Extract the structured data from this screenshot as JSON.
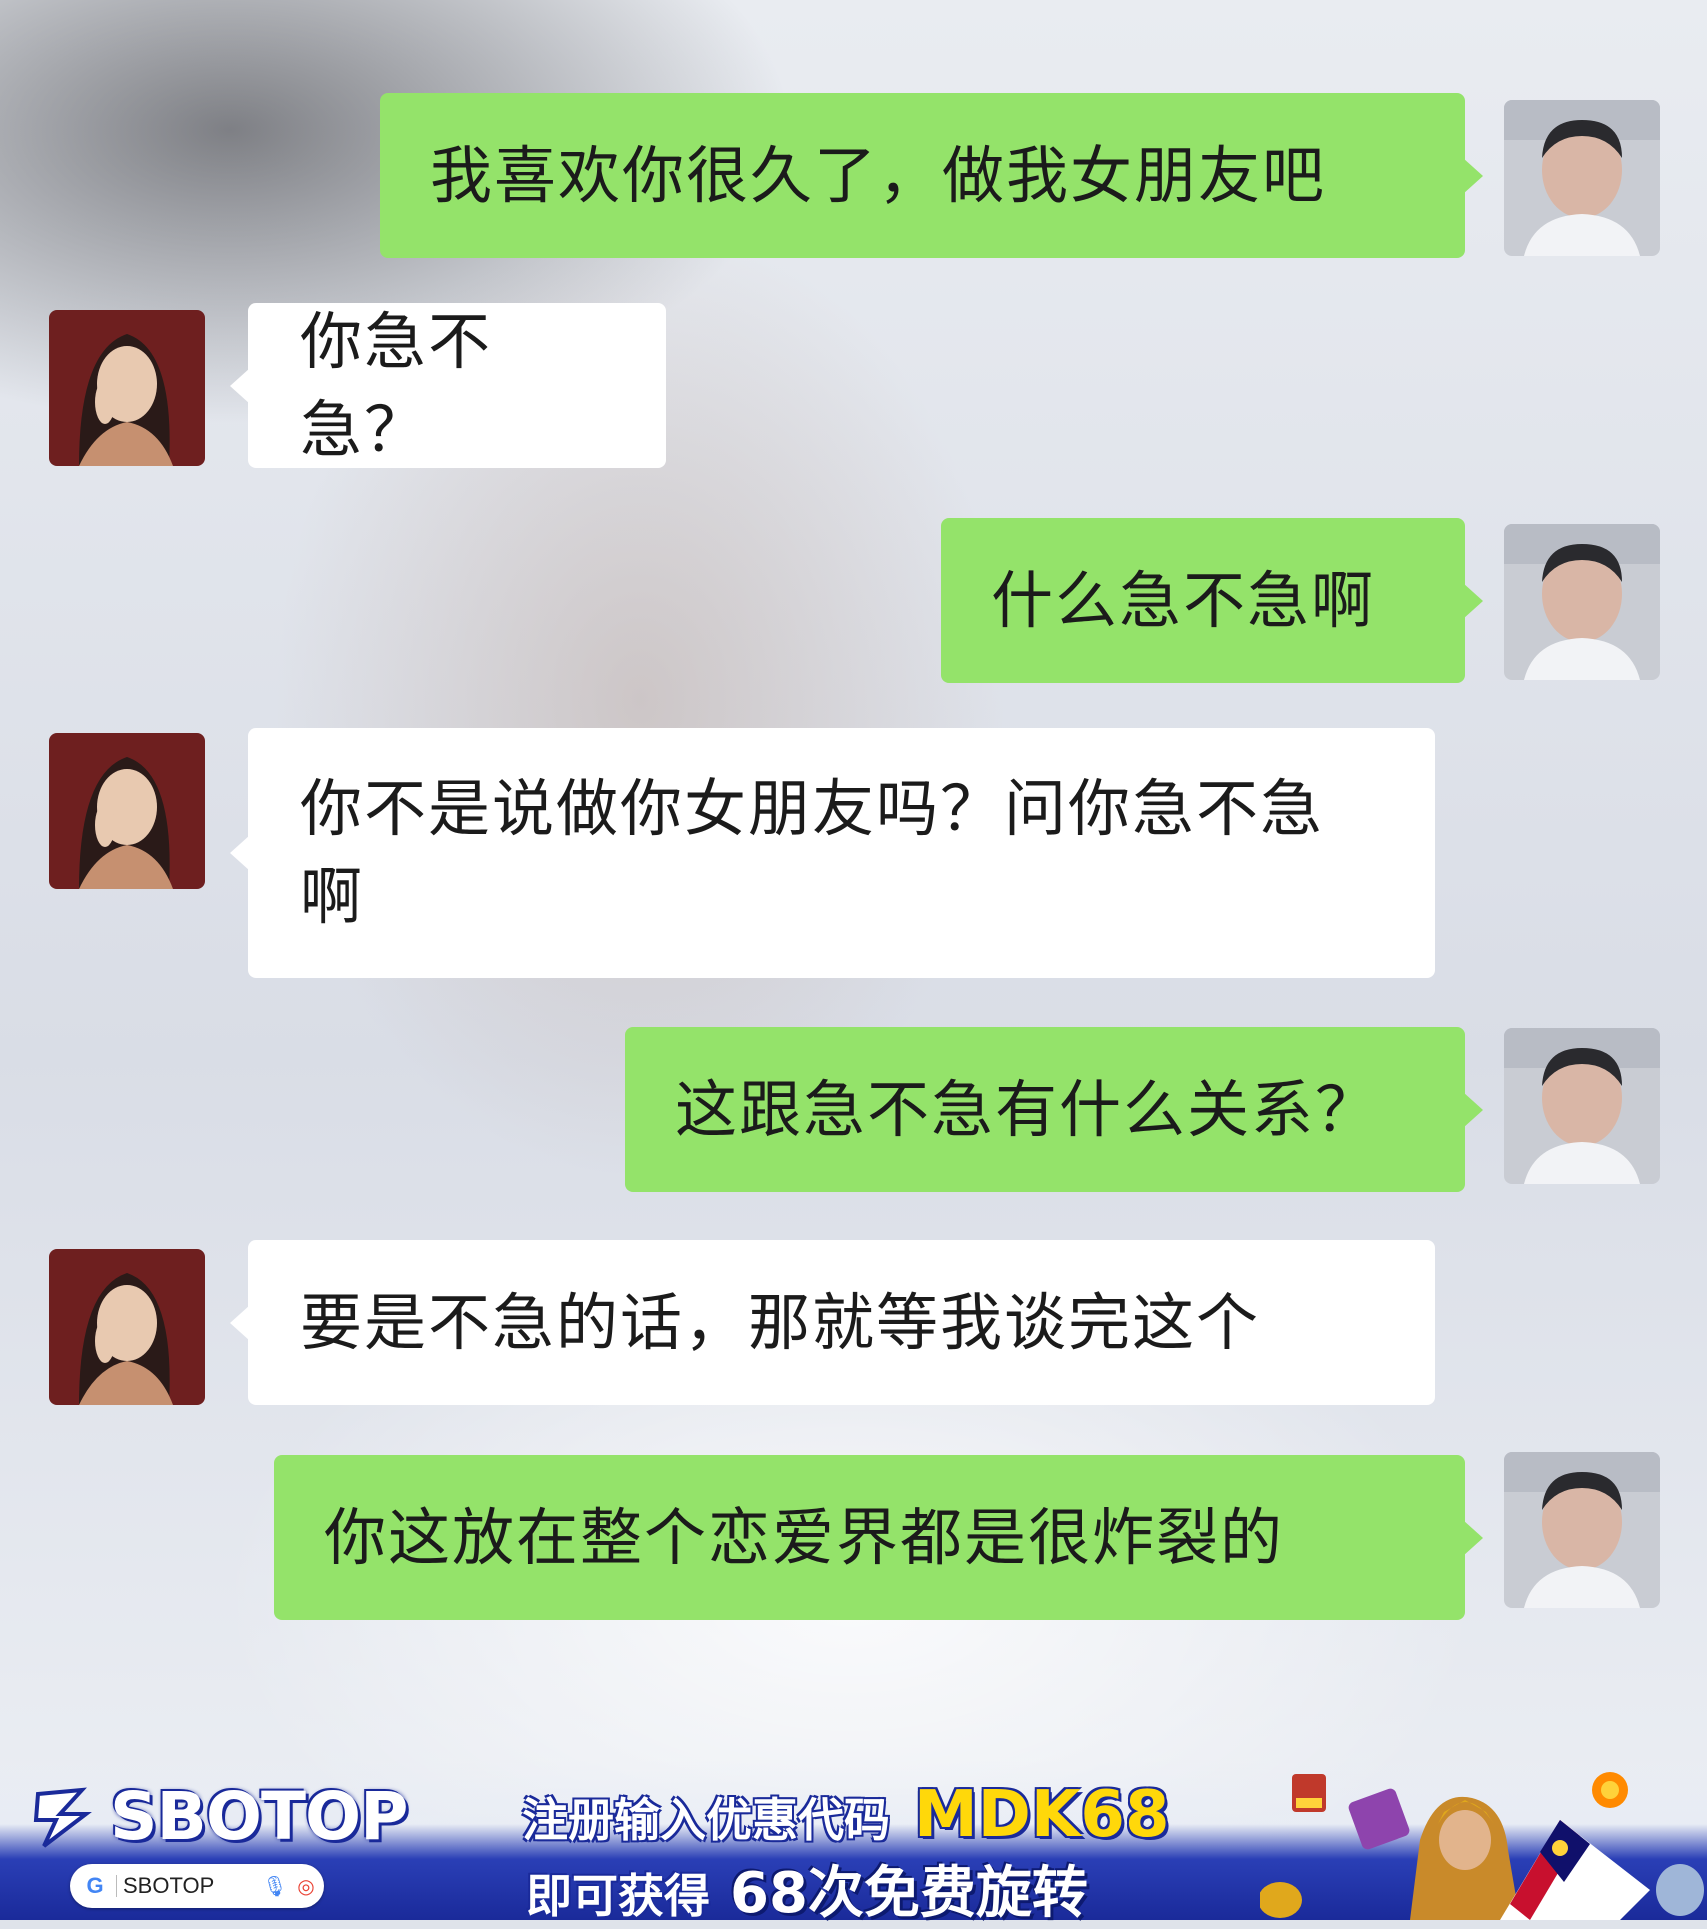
{
  "messages": [
    {
      "sender": "me",
      "text": "我喜欢你很久了，做我女朋友吧"
    },
    {
      "sender": "her",
      "text": "你急不急？"
    },
    {
      "sender": "me",
      "text": "什么急不急啊"
    },
    {
      "sender": "her",
      "text": "你不是说做你女朋友吗？问你急不急啊"
    },
    {
      "sender": "me",
      "text": "这跟急不急有什么关系？"
    },
    {
      "sender": "her",
      "text": "要是不急的话，那就等我谈完这个"
    },
    {
      "sender": "me",
      "text": "你这放在整个恋爱界都是很炸裂的"
    }
  ],
  "banner": {
    "brand": "SBOTOP",
    "search_query": "SBOTOP",
    "promo_line1": "注册输入优惠代码",
    "promo_code": "MDK68",
    "promo_line2_prefix": "即可获得",
    "promo_line2_highlight": "68次免费旋转"
  },
  "colors": {
    "my_bubble": "#94e36a",
    "her_bubble": "#ffffff",
    "banner_blue": "#1a2a9a",
    "promo_code": "#ffd80a"
  }
}
